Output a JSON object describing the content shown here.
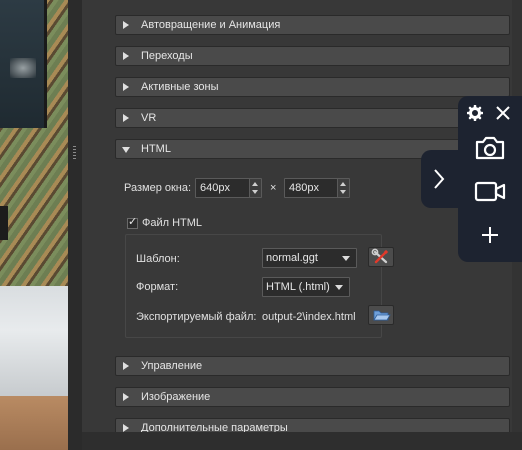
{
  "sections": {
    "autorotation": "Автовращение и Анимация",
    "transitions": "Переходы",
    "hotspots": "Активные зоны",
    "vr": "VR",
    "html": "HTML",
    "control": "Управление",
    "image": "Изображение",
    "advanced": "Дополнительные параметры"
  },
  "html_section": {
    "window_size_label": "Размер окна:",
    "width_value": "640px",
    "times_sign": "×",
    "height_value": "480px",
    "html_file_label": "Файл HTML",
    "html_file_checked": true,
    "template_label": "Шаблон:",
    "template_value": "normal.ggt",
    "format_label": "Формат:",
    "format_value": "HTML (.html)",
    "export_label": "Экспортируемый файл:",
    "export_value": "output-2\\index.html"
  },
  "icons": {
    "template_edit": "wrench-screwdriver-icon",
    "export_browse": "open-folder-icon",
    "toolbar": [
      "gear-icon",
      "close-icon",
      "camera-icon",
      "chevron-right-icon",
      "video-camera-icon",
      "plus-icon"
    ]
  },
  "colors": {
    "panel_bg": "#383838",
    "section_header_bg": "#4a4a4a",
    "field_bg": "#2c2c2c",
    "toolbar_bg": "#1d2330",
    "toolbar_icon": "#ffffff"
  }
}
